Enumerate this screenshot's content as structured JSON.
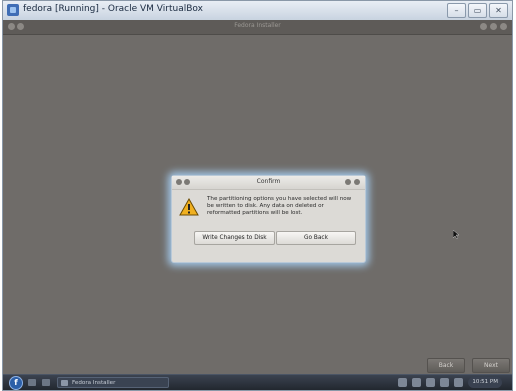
{
  "vbox": {
    "title": "fedora [Running] - Oracle VM VirtualBox",
    "controls": {
      "minimize": "–",
      "restore": "▭",
      "close": "✕"
    }
  },
  "installer": {
    "title": "Fedora Installer",
    "back_label": "Back",
    "next_label": "Next"
  },
  "dialog": {
    "title": "Confirm",
    "message": "The partitioning options you have selected will now be written to disk.  Any data on deleted or reformatted partitions will be lost.",
    "write_button": "Write Changes to Disk",
    "go_back_button": "Go Back",
    "icon": "warning-icon"
  },
  "taskbar": {
    "task_label": "Fedora Installer",
    "clock": "10:51 PM"
  },
  "colors": {
    "desktop": "#6f6c69",
    "dialog_glow": "#aad7ff",
    "warning": "#f0b020"
  }
}
